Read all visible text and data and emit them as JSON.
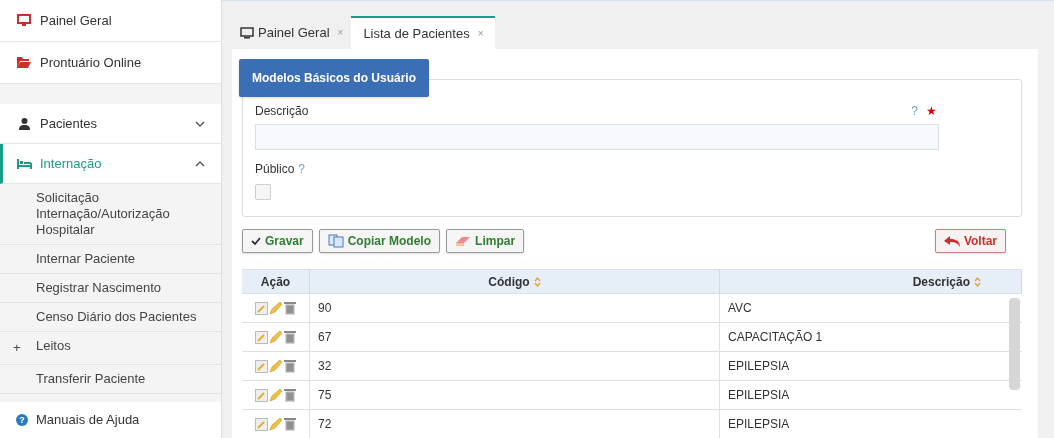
{
  "sidebar": {
    "items": [
      {
        "kind": "top",
        "label": "Painel Geral",
        "selected": false
      },
      {
        "kind": "top",
        "label": "Prontuário Online",
        "selected": false
      },
      {
        "kind": "spacer"
      },
      {
        "kind": "group",
        "label": "Pacientes",
        "selected": false,
        "expanded": false
      },
      {
        "kind": "group",
        "label": "Internação",
        "selected": true,
        "expanded": true,
        "children": [
          {
            "label": "Solicitação Internação/Autorização Hospitalar"
          },
          {
            "label": "Internar Paciente"
          },
          {
            "label": "Registrar Nascimento"
          },
          {
            "label": "Censo Diário dos Pacientes"
          },
          {
            "label": "Leitos",
            "prefix": "+"
          },
          {
            "label": "Transferir Paciente"
          }
        ]
      }
    ],
    "footer": {
      "label": "Manuais de Ajuda",
      "help_mark": "?"
    }
  },
  "tabs": [
    {
      "label": "Painel Geral",
      "selected": false,
      "close": "×"
    },
    {
      "label": "Lista de Pacientes",
      "selected": true,
      "close": "×"
    }
  ],
  "form": {
    "legend": "Modelos Básicos do Usuário",
    "description_label": "Descrição",
    "help": "?",
    "required": "★",
    "public_label": "Público",
    "public_help": "?",
    "public_checked": false
  },
  "buttons": [
    {
      "kind": "save",
      "label": "Gravar"
    },
    {
      "kind": "copy",
      "label": "Copiar Modelo"
    },
    {
      "kind": "clear",
      "label": "Limpar"
    }
  ],
  "back_button": {
    "label": "Voltar"
  },
  "table": {
    "columns": [
      {
        "label": "Ação",
        "sortable": false
      },
      {
        "label": "Código",
        "sortable": true
      },
      {
        "label": "Descrição",
        "sortable": true
      }
    ],
    "rows": [
      {
        "code": "90",
        "description": "AVC"
      },
      {
        "code": "67",
        "description": "CAPACITAÇÃO 1"
      },
      {
        "code": "32",
        "description": "EPILEPSIA"
      },
      {
        "code": "75",
        "description": "EPILEPSIA"
      },
      {
        "code": "72",
        "description": "EPILEPSIA"
      }
    ]
  }
}
